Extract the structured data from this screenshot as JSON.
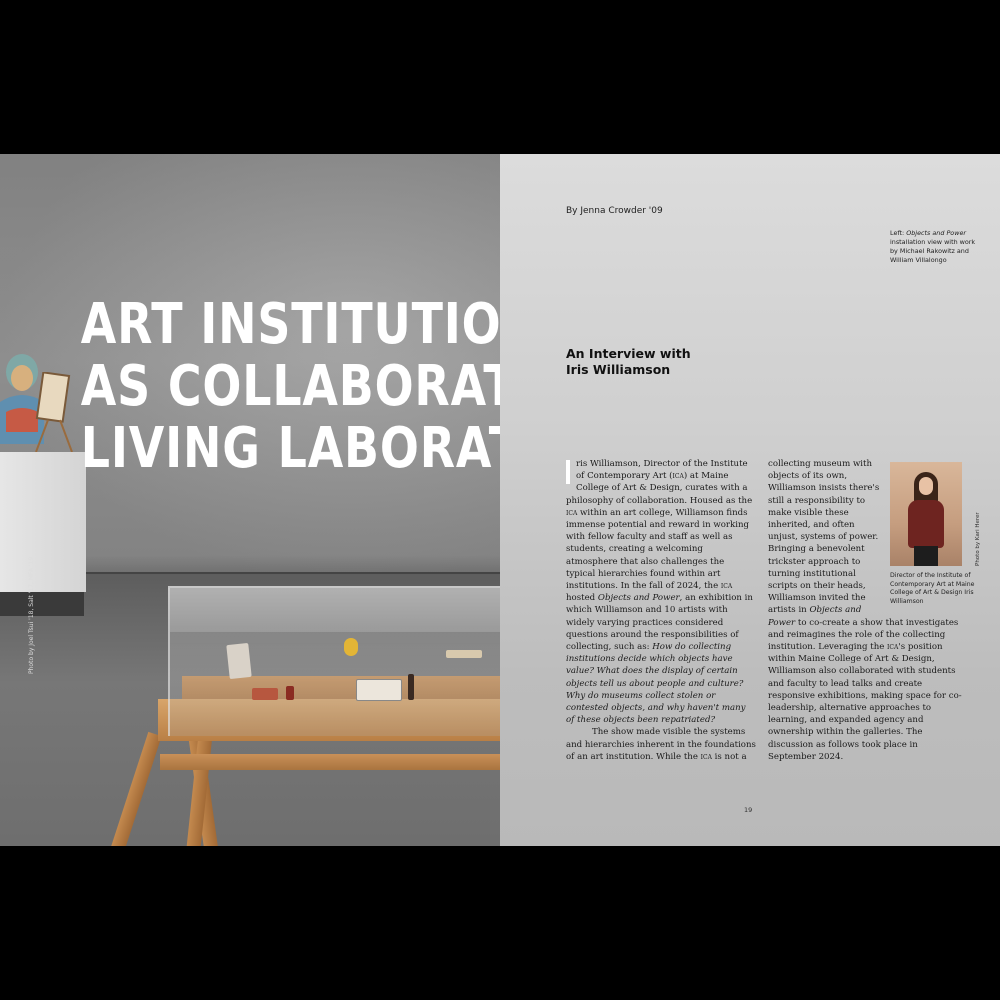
{
  "headline": {
    "line1": "ART INSTITUTION",
    "line2": "AS COLLABORATIVE,",
    "line3": "LIVING LABORATORY"
  },
  "photo_credit_left": "Photo by Joel Tsui '18, Salt '17, MFA '19",
  "byline": "By Jenna Crowder '09",
  "caption_top": {
    "prefix": "Left: ",
    "title": "Objects and Power",
    "rest": " installation view with work by Michael Rakowitz and William Villalongo"
  },
  "subtitle": {
    "line1": "An Interview with",
    "line2": "Iris Williamson"
  },
  "body": {
    "p1a": "ris Williamson, Director of the Institute of Contemporary Art (",
    "ica1": "ica",
    "p1b": ") at Maine College of Art & Design, curates with a philosophy of collaboration. Housed as the ",
    "ica2": "ica",
    "p1c": " within an art college, Williamson finds immense potential and reward in working with fellow faculty and staff as well as students, creating a welcoming atmosphere that also challenges the typical hierarchies found within art institutions. In the fall of 2024, the ",
    "ica3": "ica",
    "p1d": " hosted ",
    "exhibition": "Objects and Power",
    "p1e": ", an exhibition in which Williamson and 10 artists with widely varying practices considered questions around the responsibilities of collecting, such as: ",
    "questions": "How do collecting institutions decide which objects have value? What does the display of certain objects tell us about people and culture? Why do museums collect stolen or contested objects, and why haven't many of these objects been repatriated?",
    "p2a": "The show made visible the systems and hierarchies inherent in the foundations of an art institution. While the ",
    "ica4": "ica",
    "p2b": " is not a",
    "c2a": "collecting museum with objects of its own, Williamson insists there's still a responsibility to make visible these inherited, and often unjust, systems of power. Bringing a benevolent trickster approach to turning institutional scripts on their heads, Williamson invited the artists in ",
    "exhibition2": "Objects and Power",
    "c2b": " to co-create a show that investigates and reimagines the role of the collecting institution. Leveraging the ",
    "ica5": "ica",
    "c2c": "'s position within Maine College of Art & Design, Williamson also collaborated with students and faculty to lead talks and create responsive exhibitions, making space for co-leadership, alternative approaches to learning, and expanded agency and ownership within the galleries. The discussion as follows took place in September 2024."
  },
  "portrait_caption": "Director of the Institute of Contemporary Art at Maine College of Art & Design Iris Williamson",
  "photo_credit_right": "Photo by Kari Herer",
  "page_number": "19",
  "colors": {
    "background": "#000000",
    "right_page": "#d0d0d0",
    "headline": "#ffffff",
    "wood": "#c48a4f"
  }
}
